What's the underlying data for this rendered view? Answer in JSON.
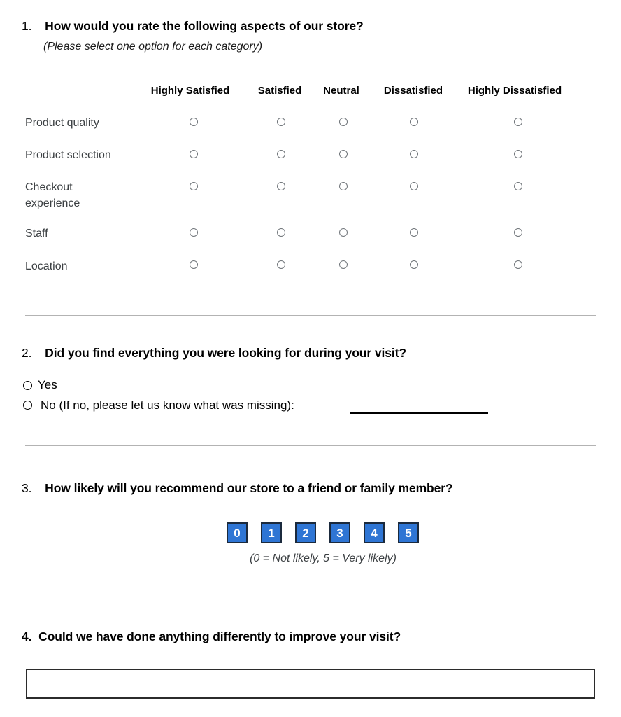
{
  "questions": {
    "q1": {
      "number": "1.",
      "text": "How would you rate the following aspects of our store?",
      "instruction": "(Please select one option for each category)",
      "columns": [
        "Highly Satisfied",
        "Satisfied",
        "Neutral",
        "Dissatisfied",
        "Highly Dissatisfied"
      ],
      "rows": [
        "Product quality",
        "Product selection",
        "Checkout\nexperience",
        "Staff",
        "Location"
      ]
    },
    "q2": {
      "number": "2.",
      "text": "Did you find everything you were looking for during your visit?",
      "options": [
        "Yes",
        "No (If no, please let us know what was missing):"
      ]
    },
    "q3": {
      "number": "3.",
      "text": "How likely will you recommend our store to a friend or family member?",
      "scale": [
        "0",
        "1",
        "2",
        "3",
        "4",
        "5"
      ],
      "caption": "(0 = Not likely, 5 = Very likely)"
    },
    "q4": {
      "number": "4.",
      "text": "Could we have done anything differently to improve your visit?",
      "answer_value": "",
      "answer_placeholder": ""
    }
  },
  "colors": {
    "scale_fill": "#2e75d4",
    "scale_border": "#1b2a3d",
    "divider": "#b3b3b3",
    "radio_stroke": "#70757a"
  }
}
